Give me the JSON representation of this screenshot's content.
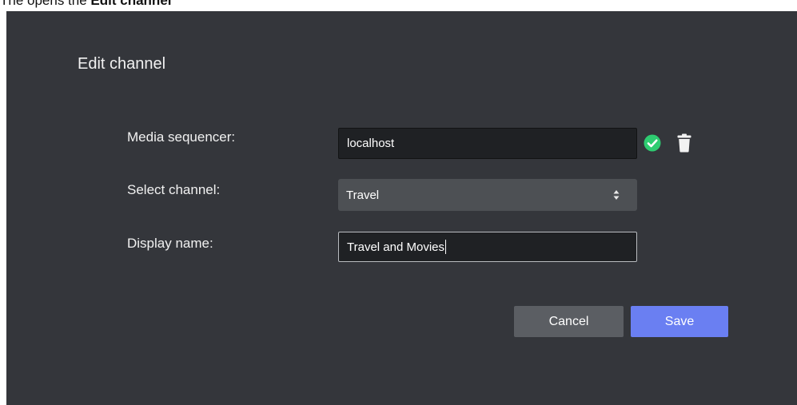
{
  "instruction_banner": {
    "text_plain": "The opens the ",
    "text_bold": "Edit channel"
  },
  "dialog": {
    "title": "Edit channel",
    "fields": {
      "media_sequencer": {
        "label": "Media sequencer:",
        "value": "localhost",
        "status": "connected"
      },
      "select_channel": {
        "label": "Select channel:",
        "selected": "Travel"
      },
      "display_name": {
        "label": "Display name:",
        "value": "Travel and Movies"
      }
    },
    "buttons": {
      "cancel_label": "Cancel",
      "save_label": "Save"
    }
  },
  "colors": {
    "dialog_bg": "#34363b",
    "input_bg": "#1f2124",
    "select_bg": "#4d5054",
    "ok_icon": "#2ecc71",
    "save_button": "#6a7ff2",
    "cancel_button": "#5b5e63"
  },
  "icons": {
    "status": "check-circle-icon",
    "delete": "trash-icon",
    "select": "sort-arrows-icon"
  }
}
